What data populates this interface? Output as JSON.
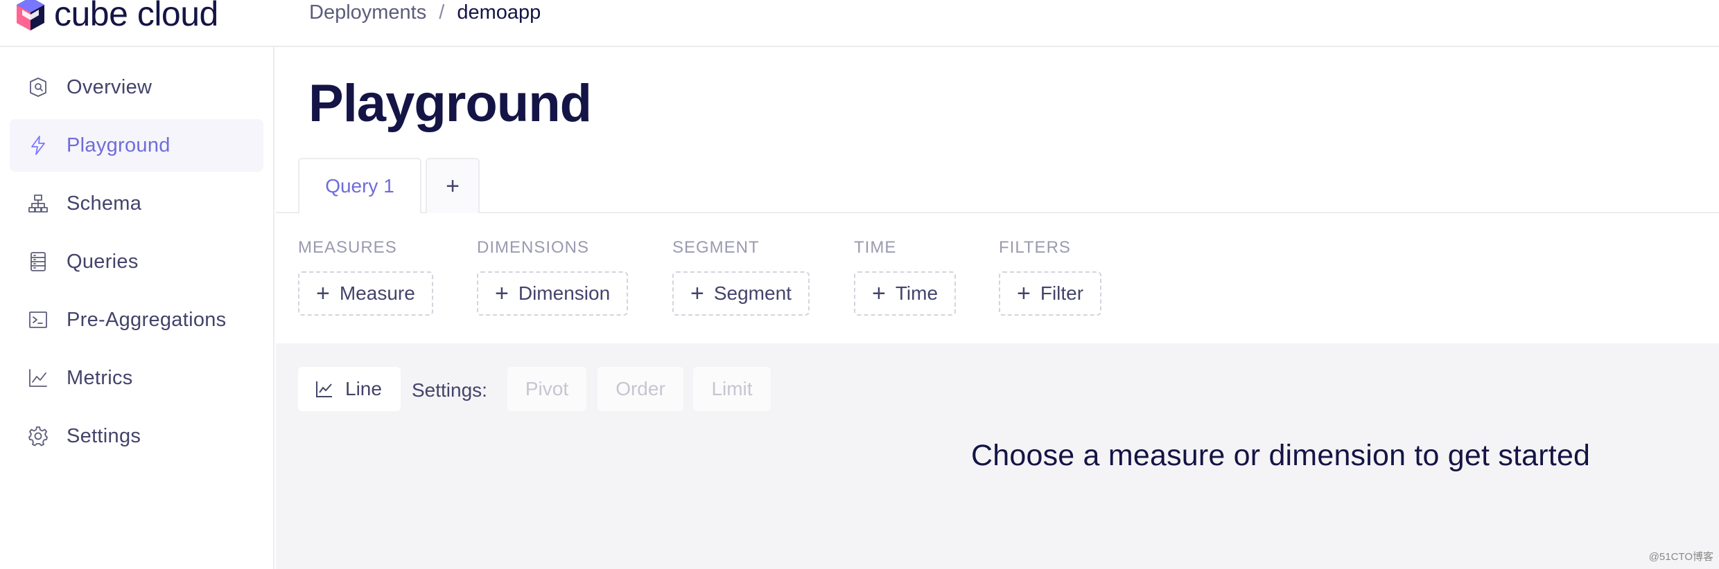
{
  "brand": {
    "name": "cube cloud"
  },
  "breadcrumb": {
    "parent": "Deployments",
    "separator": "/",
    "current": "demoapp"
  },
  "sidebar": {
    "items": [
      {
        "label": "Overview",
        "icon": "shield-icon",
        "active": false
      },
      {
        "label": "Playground",
        "icon": "lightning-icon",
        "active": true
      },
      {
        "label": "Schema",
        "icon": "hierarchy-icon",
        "active": false
      },
      {
        "label": "Queries",
        "icon": "list-icon",
        "active": false
      },
      {
        "label": "Pre-Aggregations",
        "icon": "terminal-icon",
        "active": false
      },
      {
        "label": "Metrics",
        "icon": "line-chart-icon",
        "active": false
      },
      {
        "label": "Settings",
        "icon": "gear-icon",
        "active": false
      }
    ]
  },
  "main": {
    "title": "Playground",
    "tabs": [
      {
        "label": "Query 1",
        "active": true
      }
    ],
    "add_tab_label": "+",
    "groups": [
      {
        "label": "MEASURES",
        "button": "Measure"
      },
      {
        "label": "DIMENSIONS",
        "button": "Dimension"
      },
      {
        "label": "SEGMENT",
        "button": "Segment"
      },
      {
        "label": "TIME",
        "button": "Time"
      },
      {
        "label": "FILTERS",
        "button": "Filter"
      }
    ],
    "plus_glyph": "+",
    "chart_type": "Line",
    "settings_label": "Settings:",
    "settings_buttons": [
      "Pivot",
      "Order",
      "Limit"
    ],
    "empty_message": "Choose a measure or dimension to get started"
  },
  "watermark": "@51CTO博客",
  "colors": {
    "accent": "#6f6cdb",
    "text": "#141446",
    "muted": "#9a9ab0",
    "panel": "#f4f4f6"
  }
}
